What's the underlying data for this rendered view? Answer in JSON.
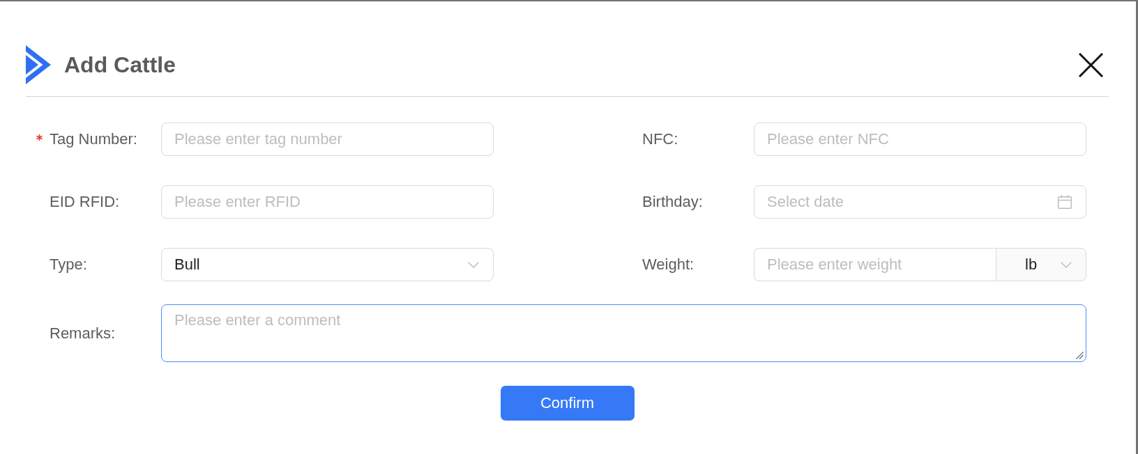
{
  "dialog": {
    "title": "Add Cattle"
  },
  "fields": [
    {
      "kind": "text",
      "label": "Tag Number:",
      "required": true,
      "focused": false,
      "placeholder": "Please enter tag number"
    },
    {
      "kind": "text",
      "label": "NFC:",
      "required": false,
      "focused": false,
      "placeholder": "Please enter NFC"
    },
    {
      "kind": "text",
      "label": "EID RFID:",
      "required": false,
      "focused": false,
      "placeholder": "Please enter RFID"
    },
    {
      "kind": "date",
      "label": "Birthday:",
      "required": false,
      "focused": false,
      "placeholder": "Select date"
    },
    {
      "kind": "select",
      "label": "Type:",
      "required": false,
      "focused": false,
      "value": "Bull"
    },
    {
      "kind": "unit",
      "label": "Weight:",
      "required": false,
      "focused": false,
      "placeholder": "Please enter weight",
      "unit": "lb"
    },
    {
      "kind": "textarea",
      "label": "Remarks:",
      "required": false,
      "focused": true,
      "placeholder": "Please enter a comment"
    }
  ],
  "buttons": [
    "Confirm"
  ]
}
